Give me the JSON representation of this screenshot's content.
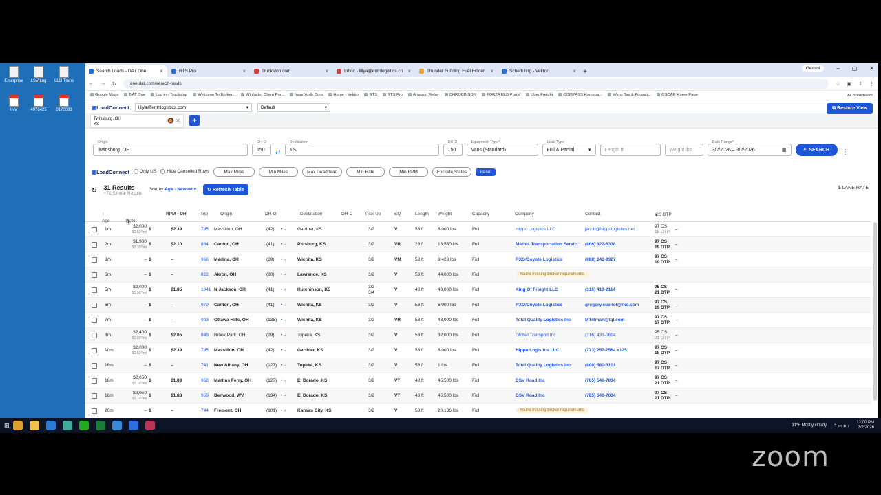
{
  "desktop": {
    "icons": [
      {
        "label": "Enterprise"
      },
      {
        "label": "LSV Log"
      },
      {
        "label": "LLO Trans"
      },
      {
        "label": "INV"
      },
      {
        "label": "4078425"
      },
      {
        "label": "0170083"
      }
    ]
  },
  "browser": {
    "tabs": [
      {
        "label": "Search Loads - DAT One",
        "active": true
      },
      {
        "label": "RTS Pro"
      },
      {
        "label": "Truckstop.com"
      },
      {
        "label": "Inbox - liliya@entnlogistics.co"
      },
      {
        "label": "Thunder Funding Fuel Finder"
      },
      {
        "label": "Scheduling - Vektor"
      }
    ],
    "gemini": "Gemini",
    "url": "one.dat.com/search-loads",
    "bookmarks": [
      "Google Maps",
      "DAT One",
      "Log in - Truckstop",
      "Welcome To Broker...",
      "Winfactor Client Por...",
      "InsurNorth Corp",
      "Home - Vektor",
      "RTS",
      "RTS Pro",
      "Amazon Relay",
      "CHROBINSON",
      "FORZA ELD Portal",
      "Uber Freight",
      "COMPASS Homepa...",
      "Wenz Tax & Financi...",
      "OSCAR Home Page"
    ],
    "all_bookmarks": "All Bookmarks"
  },
  "app": {
    "logo": "LoadConnect",
    "account": "liliya@entnlogistics.com",
    "preset": "Default",
    "restore_view": "Restore View",
    "search_tab": {
      "origin": "Twinsburg, OH",
      "dest": "KS"
    },
    "filters": {
      "origin_label": "Origin",
      "origin": "Twinsburg, OH",
      "dho_label": "DH-O",
      "dho": "150",
      "dest_label": "Destination",
      "dest": "KS",
      "dhd_label": "DH-D",
      "dhd": "150",
      "equip_label": "Equipment Type*",
      "equip": "Vans (Standard)",
      "loadtype_label": "Load Type",
      "loadtype": "Full & Partial",
      "length_ph": "Length ft",
      "weight_ph": "Weight lbs",
      "date_label": "Date Range*",
      "date": "3/2/2026 – 3/2/2026",
      "search": "SEARCH"
    },
    "row2": {
      "logo": "LoadConnect",
      "only_us": "Only US",
      "hide_cancelled": "Hide Cancelled Rows",
      "chips": [
        "Max Miles",
        "Min Miles",
        "Max Deadhead",
        "Min Rate",
        "Min RPM",
        "Exclude States"
      ],
      "reset": "Reset"
    },
    "results": {
      "count": "31 Results",
      "similar": "+71 Similar Results",
      "sort_label": "Sort by",
      "sort_value": "Age - Newest",
      "refresh": "Refresh Table",
      "lane_rate": "LANE RATE"
    },
    "columns": [
      "Age",
      "Rate",
      "RPM • DH",
      "Trip",
      "Origin",
      "DH-O",
      "Destination",
      "DH-D",
      "Pick Up",
      "EQ",
      "Length",
      "Weight",
      "Capacity",
      "Company",
      "Contact",
      "CS DTP"
    ],
    "rows": [
      {
        "age": "1m",
        "rate": "$2,000",
        "rpm_sub": "$2.52*/mi",
        "rpm": "$2.39",
        "trip": "795",
        "origin": "Massillon, OH",
        "dho": "(42)",
        "dest": "Gardner, KS",
        "pick": "3/2",
        "eq": "V",
        "len": "53 ft",
        "wt": "8,000 lbs",
        "cap": "Full",
        "company": "Hippo Logistics LLC",
        "contact": "jacob@hippologistics.net",
        "cs": "97 CS",
        "dtp": "18 DTP",
        "dim": true
      },
      {
        "age": "2m",
        "rate": "$1,900",
        "rpm_sub": "$2.20*/mi",
        "rpm": "$2.10",
        "trip": "864",
        "origin": "Canton, OH",
        "dho": "(41)",
        "dest": "Pittsburg, KS",
        "pick": "3/2",
        "eq": "VR",
        "len": "28 ft",
        "wt": "13,560 lbs",
        "cap": "Full",
        "company": "Mathis Transportation Servic...",
        "contact": "(806) 622-8338",
        "cs": "97 CS",
        "dtp": "19 DTP"
      },
      {
        "age": "3m",
        "rate": "–",
        "rpm_sub": "",
        "rpm": "–",
        "trip": "966",
        "origin": "Medina, OH",
        "dho": "(29)",
        "dest": "Wichita, KS",
        "pick": "3/2",
        "eq": "VM",
        "len": "53 ft",
        "wt": "3,428 lbs",
        "cap": "Full",
        "company": "RXO/Coyote Logistics",
        "contact": "(888) 242-9327",
        "cs": "97 CS",
        "dtp": "19 DTP"
      },
      {
        "age": "5m",
        "rate": "–",
        "rpm_sub": "",
        "rpm": "–",
        "trip": "822",
        "origin": "Akron, OH",
        "dho": "(20)",
        "dest": "Lawrence, KS",
        "pick": "3/2",
        "eq": "V",
        "len": "53 ft",
        "wt": "44,000 lbs",
        "cap": "Full",
        "company": "",
        "warn": "You're missing broker requirements",
        "contact": "",
        "cs": "",
        "dtp": ""
      },
      {
        "age": "5m",
        "rate": "$2,000",
        "rpm_sub": "$1.92*/mi",
        "rpm": "$1.85",
        "trip": "1041",
        "origin": "N Jackson, OH",
        "dho": "(41)",
        "dest": "Hutchinson, KS",
        "pick": "3/2 - 3/4",
        "eq": "V",
        "len": "48 ft",
        "wt": "43,000 lbs",
        "cap": "Full",
        "company": "King Of Freight LLC",
        "contact": "(316) 413-2114",
        "cs": "95 CS",
        "dtp": "21 DTP"
      },
      {
        "age": "6m",
        "rate": "–",
        "rpm_sub": "",
        "rpm": "–",
        "trip": "979",
        "origin": "Canton, OH",
        "dho": "(41)",
        "dest": "Wichita, KS",
        "pick": "3/2",
        "eq": "V",
        "len": "53 ft",
        "wt": "6,000 lbs",
        "cap": "Full",
        "company": "RXO/Coyote Logistics",
        "contact": "gregory.cuenot@rxo.com",
        "cs": "97 CS",
        "dtp": "19 DTP"
      },
      {
        "age": "7m",
        "rate": "–",
        "rpm_sub": "",
        "rpm": "–",
        "trip": "903",
        "origin": "Ottawa Hills, OH",
        "dho": "(135)",
        "dest": "Wichita, KS",
        "pick": "3/2",
        "eq": "VR",
        "len": "53 ft",
        "wt": "43,000 lbs",
        "cap": "Full",
        "company": "Total Quality Logistics Inc",
        "contact": "MTillman@tql.com",
        "cs": "97 CS",
        "dtp": "17 DTP"
      },
      {
        "age": "8m",
        "rate": "$2,400",
        "rpm_sub": "$2.83*/mi",
        "rpm": "$2.05",
        "trip": "849",
        "origin": "Brook Park, OH",
        "dho": "(29)",
        "dest": "Topeka, KS",
        "pick": "3/2",
        "eq": "V",
        "len": "53 ft",
        "wt": "32,000 lbs",
        "cap": "Full",
        "company": "Global Transport Inc",
        "contact": "(216) 431-0694",
        "cs": "95 CS",
        "dtp": "21 DTP",
        "dim": true
      },
      {
        "age": "10m",
        "rate": "$2,000",
        "rpm_sub": "$2.52*/mi",
        "rpm": "$2.39",
        "trip": "795",
        "origin": "Massillon, OH",
        "dho": "(42)",
        "dest": "Gardner, KS",
        "pick": "3/2",
        "eq": "V",
        "len": "53 ft",
        "wt": "8,000 lbs",
        "cap": "Full",
        "company": "Hippo Logistics LLC",
        "contact": "(773) 257-7564 x125",
        "cs": "97 CS",
        "dtp": "18 DTP"
      },
      {
        "age": "16m",
        "rate": "–",
        "rpm_sub": "",
        "rpm": "–",
        "trip": "741",
        "origin": "New Albany, OH",
        "dho": "(127)",
        "dest": "Topeka, KS",
        "pick": "3/2",
        "eq": "V",
        "len": "53 ft",
        "wt": "1 lbs",
        "cap": "Full",
        "company": "Total Quality Logistics Inc",
        "contact": "(800) 580-3101",
        "cs": "97 CS",
        "dtp": "17 DTP"
      },
      {
        "age": "18m",
        "rate": "$2,050",
        "rpm_sub": "$2.14*/mi",
        "rpm": "$1.89",
        "trip": "958",
        "origin": "Martins Ferry, OH",
        "dho": "(127)",
        "dest": "El Dorado, KS",
        "pick": "3/2",
        "eq": "VT",
        "len": "48 ft",
        "wt": "45,500 lbs",
        "cap": "Full",
        "company": "DSV Road Inc",
        "contact": "(785) 546-7034",
        "cs": "97 CS",
        "dtp": "21 DTP"
      },
      {
        "age": "18m",
        "rate": "$2,050",
        "rpm_sub": "$2.14*/mi",
        "rpm": "$1.88",
        "trip": "959",
        "origin": "Benwood, WV",
        "dho": "(134)",
        "dest": "El Dorado, KS",
        "pick": "3/2",
        "eq": "VT",
        "len": "48 ft",
        "wt": "45,500 lbs",
        "cap": "Full",
        "company": "DSV Road Inc",
        "contact": "(785) 546-7034",
        "cs": "97 CS",
        "dtp": "21 DTP"
      },
      {
        "age": "20m",
        "rate": "–",
        "rpm_sub": "",
        "rpm": "–",
        "trip": "744",
        "origin": "Fremont, OH",
        "dho": "(101)",
        "dest": "Kansas City, KS",
        "pick": "3/2",
        "eq": "V",
        "len": "53 ft",
        "wt": "20,136 lbs",
        "cap": "Full",
        "company": "",
        "warn": "You're missing broker requirements",
        "contact": "",
        "cs": "",
        "dtp": ""
      }
    ]
  },
  "taskbar": {
    "weather": "31°F  Mostly cloudy",
    "time": "12:00 PM",
    "date": "3/2/2026"
  },
  "overlay": {
    "zoom": "zoom"
  },
  "colors": {
    "accent": "#1d56d8",
    "desktop": "#1f6fb8"
  }
}
